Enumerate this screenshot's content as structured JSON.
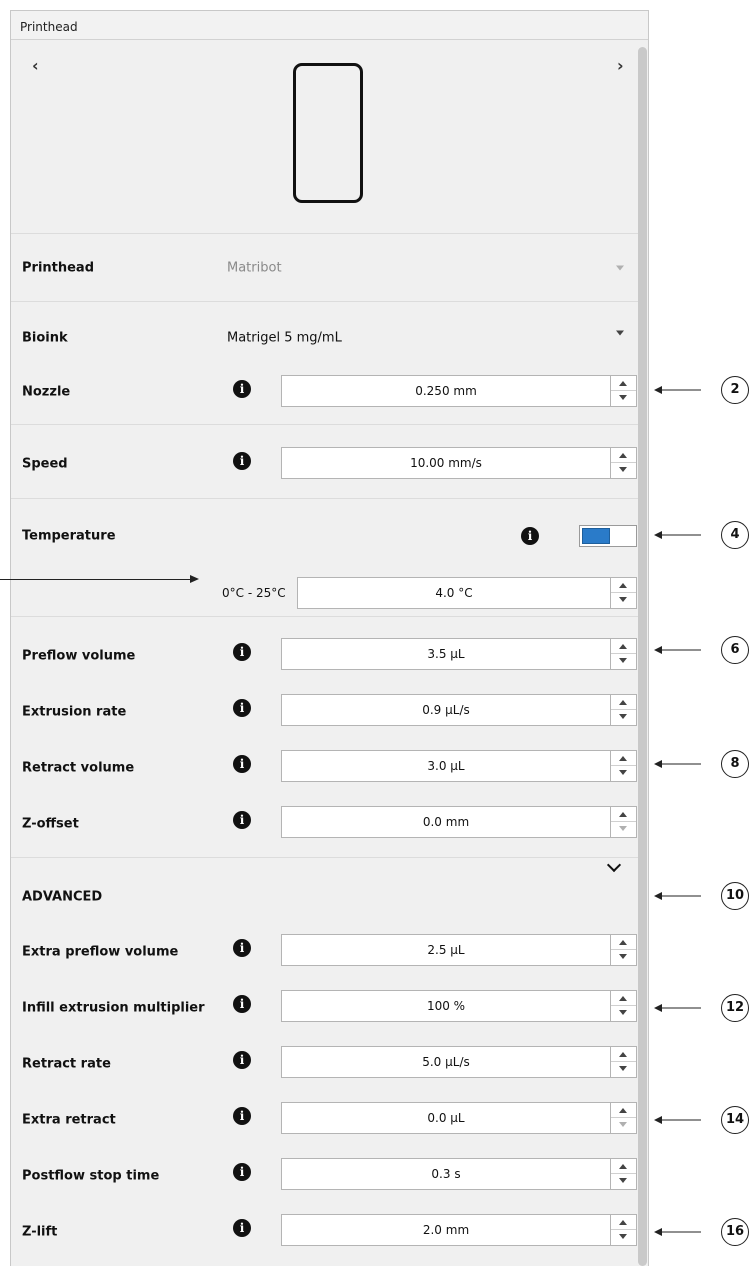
{
  "panel": {
    "title": "Printhead",
    "prev_label": "‹",
    "next_label": "›",
    "preview_icon": "printhead-outline"
  },
  "printhead": {
    "label": "Printhead",
    "value": "Matribot"
  },
  "bioink": {
    "label": "Bioink",
    "value": "Matrigel 5 mg/mL"
  },
  "nozzle": {
    "label": "Nozzle",
    "value": "0.250 mm"
  },
  "speed": {
    "label": "Speed",
    "value": "10.00 mm/s"
  },
  "temperature": {
    "label": "Temperature",
    "toggle_on": true,
    "range": "0°C - 25°C",
    "value": "4.0 °C"
  },
  "preflow_volume": {
    "label": "Preflow volume",
    "value": "3.5 µL"
  },
  "extrusion_rate": {
    "label": "Extrusion rate",
    "value": "0.9 µL/s"
  },
  "retract_volume": {
    "label": "Retract volume",
    "value": "3.0 µL"
  },
  "z_offset": {
    "label": "Z-offset",
    "value": "0.0 mm"
  },
  "advanced": {
    "label": "ADVANCED"
  },
  "extra_preflow_volume": {
    "label": "Extra preflow volume",
    "value": "2.5 µL"
  },
  "infill_extrusion_multiplier": {
    "label": "Infill extrusion multiplier",
    "value": "100 %"
  },
  "retract_rate": {
    "label": "Retract rate",
    "value": "5.0 µL/s"
  },
  "extra_retract": {
    "label": "Extra retract",
    "value": "0.0 µL"
  },
  "postflow_stop_time": {
    "label": "Postflow stop time",
    "value": "0.3 s"
  },
  "z_lift": {
    "label": "Z-lift",
    "value": "2.0 mm"
  },
  "callouts": [
    "2",
    "4",
    "6",
    "8",
    "10",
    "12",
    "14",
    "16"
  ],
  "colors": {
    "toggle_accent": "#2a7bc9",
    "panel_bg": "#f0f0f0"
  },
  "info_icon_glyph": "i"
}
